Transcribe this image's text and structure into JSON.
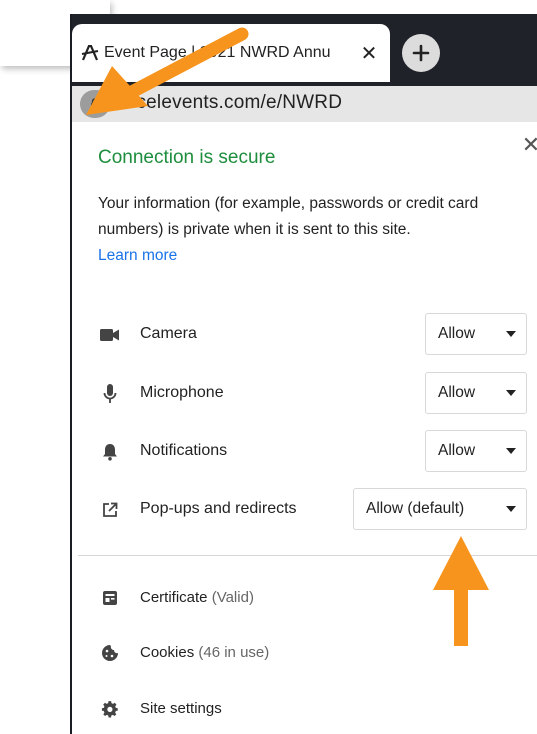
{
  "tab": {
    "title": "Event Page | 2021 NWRD Annu",
    "close_glyph": "✕",
    "new_tab_glyph": "+"
  },
  "omnibox": {
    "url": "accelevents.com/e/NWRD"
  },
  "popup": {
    "close_glyph": "✕",
    "title": "Connection is secure",
    "body": "Your information (for example, passwords or credit card numbers) is private when it is sent to this site.",
    "learn_more": "Learn more",
    "permissions": [
      {
        "label": "Camera",
        "value": "Allow",
        "icon": "camera-icon"
      },
      {
        "label": "Microphone",
        "value": "Allow",
        "icon": "microphone-icon"
      },
      {
        "label": "Notifications",
        "value": "Allow",
        "icon": "bell-icon"
      },
      {
        "label": "Pop-ups and redirects",
        "value": "Allow (default)",
        "icon": "external-link-icon"
      }
    ],
    "info_items": [
      {
        "label": "Certificate",
        "sub": "(Valid)",
        "icon": "certificate-icon"
      },
      {
        "label": "Cookies",
        "sub": "(46 in use)",
        "icon": "cookie-icon"
      },
      {
        "label": "Site settings",
        "sub": "",
        "icon": "gear-icon"
      }
    ]
  },
  "colors": {
    "secure_green": "#1e8e3e",
    "link_blue": "#1a73e8",
    "arrow_orange": "#f7941d",
    "tabstrip_dark": "#1f2329"
  }
}
